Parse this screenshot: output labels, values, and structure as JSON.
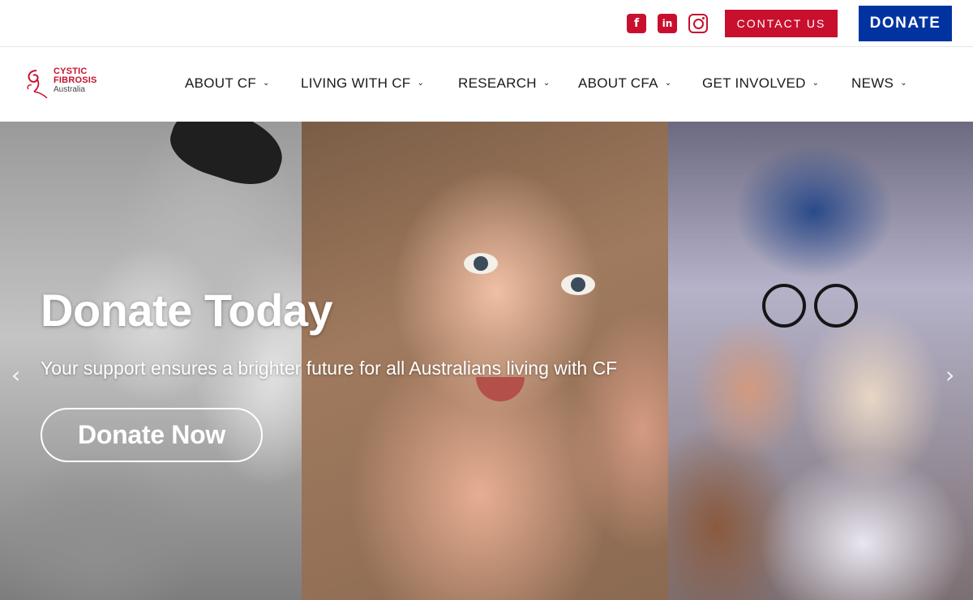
{
  "topbar": {
    "social": [
      {
        "name": "facebook-icon",
        "glyph": "f"
      },
      {
        "name": "linkedin-icon",
        "glyph": "in"
      },
      {
        "name": "instagram-icon"
      }
    ],
    "contact_label": "CONTACT US",
    "donate_label": "DONATE"
  },
  "brand": {
    "line1": "CYSTIC",
    "line2": "FIBROSIS",
    "line3": "Australia"
  },
  "nav": {
    "items": [
      {
        "label": "ABOUT CF"
      },
      {
        "label": "LIVING WITH CF"
      },
      {
        "label": "RESEARCH"
      },
      {
        "label": "ABOUT CFA"
      },
      {
        "label": "GET INVOLVED"
      },
      {
        "label": "NEWS"
      }
    ],
    "chevron": "⌄"
  },
  "hero": {
    "title": "Donate Today",
    "subtitle": "Your support ensures a brighter future for all Australians living with CF",
    "cta_label": "Donate Now",
    "prev_glyph": "‹",
    "next_glyph": "›"
  },
  "colors": {
    "brand_red": "#c8102e",
    "brand_blue": "#0033a0"
  }
}
